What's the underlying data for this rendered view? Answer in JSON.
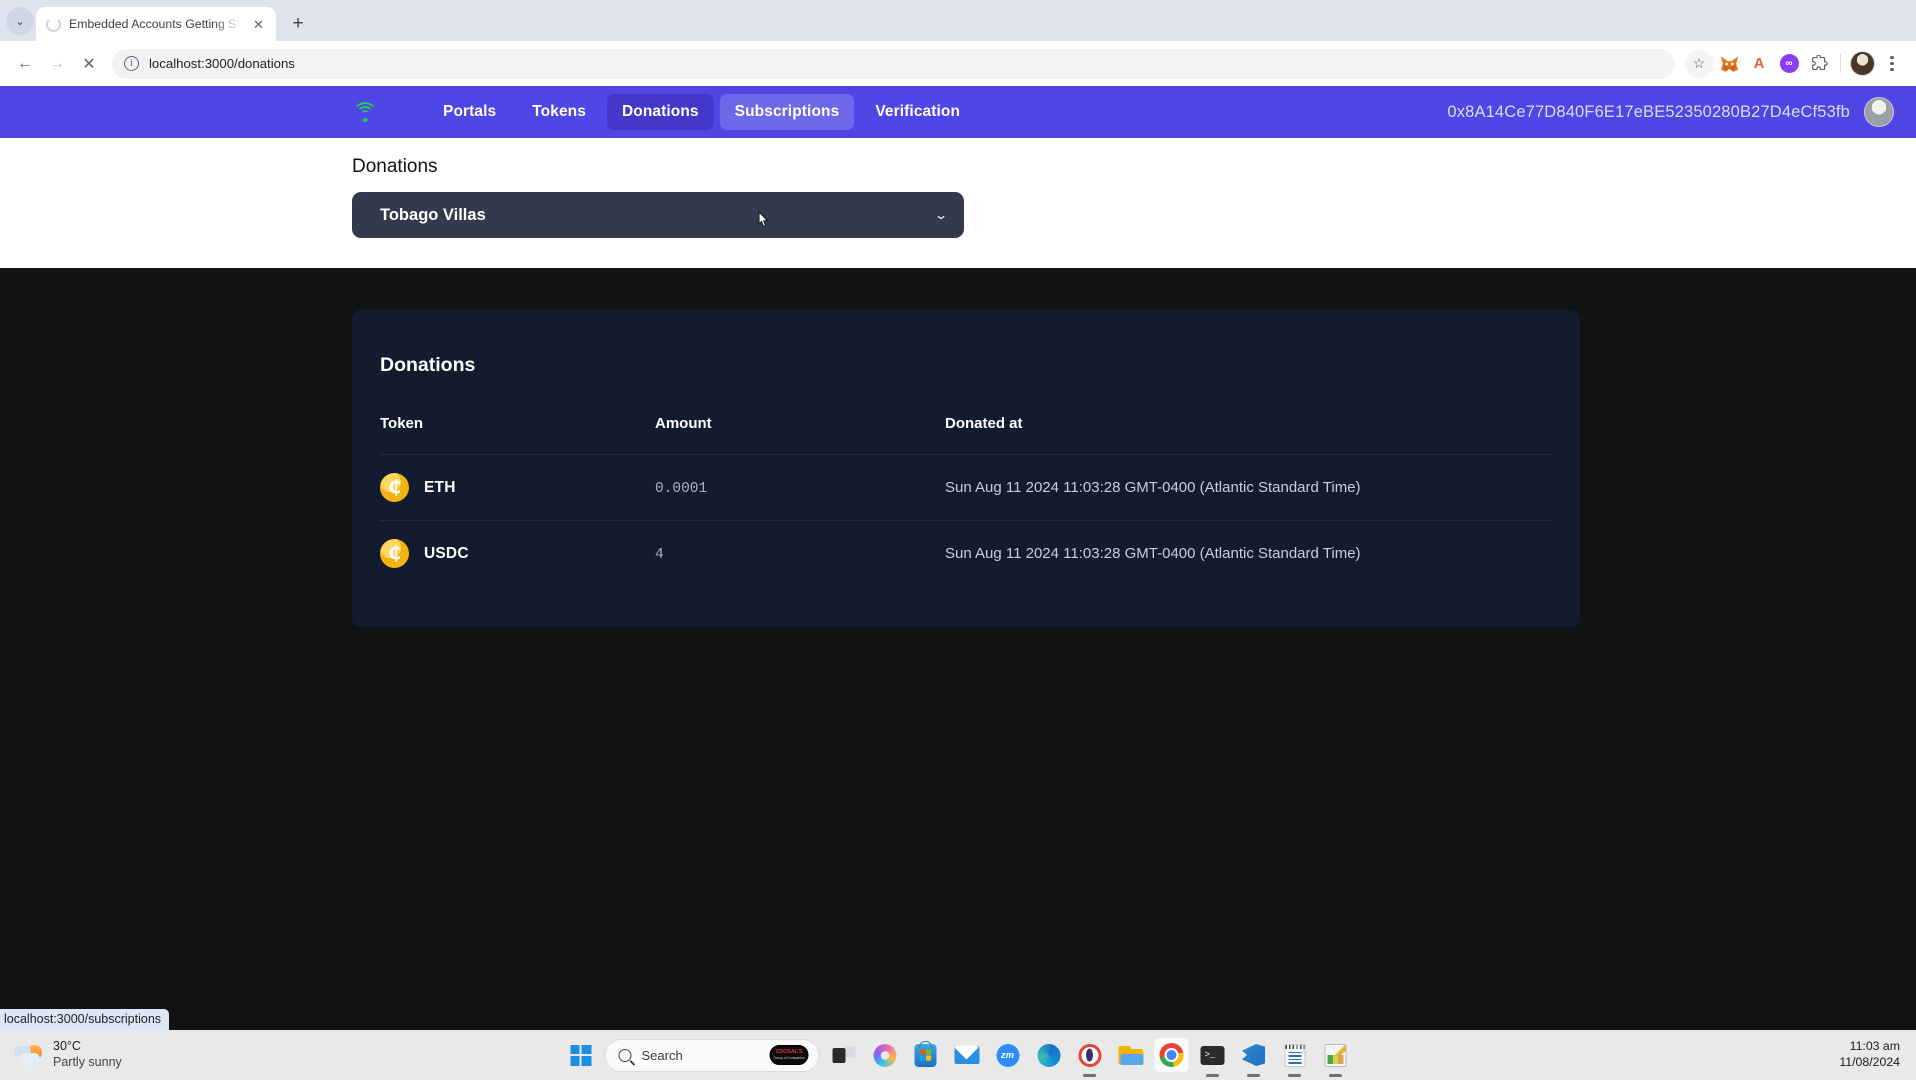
{
  "browser": {
    "tab": {
      "title": "Embedded Accounts Getting St",
      "close_label": "✕",
      "loading": true
    },
    "new_tab_label": "+",
    "tab_list_chevron": "⌄",
    "nav": {
      "back": "←",
      "forward": "→",
      "stop": "✕"
    },
    "omnibox": {
      "url": "localhost:3000/donations",
      "info_glyph": "i"
    },
    "toolbar_icons": [
      {
        "name": "bookmark-star-icon",
        "glyph": "☆"
      },
      {
        "name": "metamask-extension-icon",
        "glyph": "🦊"
      },
      {
        "name": "extension-a-icon",
        "glyph": "A"
      },
      {
        "name": "purple-extension-icon",
        "glyph": "∞"
      },
      {
        "name": "extensions-puzzle-icon",
        "glyph": "⬚"
      }
    ],
    "menu_label": "⋮",
    "status_bubble": "localhost:3000/subscriptions"
  },
  "app": {
    "brand_icon": "wifi-icon",
    "accent_color": "#4f46e5",
    "active_pill_color": "#4338ca",
    "nav_links": [
      {
        "label": "Portals",
        "state": "default"
      },
      {
        "label": "Tokens",
        "state": "default"
      },
      {
        "label": "Donations",
        "state": "active"
      },
      {
        "label": "Subscriptions",
        "state": "hover"
      },
      {
        "label": "Verification",
        "state": "default"
      }
    ],
    "wallet_address": "0x8A14Ce77D840F6E17eBE52350280B27D4eCf53fb",
    "avatar": "user-avatar"
  },
  "page": {
    "heading": "Donations",
    "portal_select": {
      "value": "Tobago Villas",
      "chevron": "⌄"
    },
    "card": {
      "title": "Donations",
      "columns": [
        "Token",
        "Amount",
        "Donated at"
      ],
      "rows": [
        {
          "token": "ETH",
          "token_icon": "coin-icon",
          "token_glyph": "₵",
          "amount": "0.0001",
          "donated_at": "Sun Aug 11 2024 11:03:28 GMT-0400 (Atlantic Standard Time)"
        },
        {
          "token": "USDC",
          "token_icon": "coin-icon",
          "token_glyph": "₵",
          "amount": "4",
          "donated_at": "Sun Aug 11 2024 11:03:28 GMT-0400 (Atlantic Standard Time)"
        }
      ]
    }
  },
  "taskbar": {
    "weather": {
      "temperature": "30°C",
      "condition": "Partly sunny"
    },
    "search_placeholder": "Search",
    "search_badge": {
      "line1": "CDOSAL'S",
      "line2": "Group of Companies"
    },
    "apps": [
      {
        "name": "start-button",
        "label": "Start"
      },
      {
        "name": "task-view-button",
        "label": "Task View"
      },
      {
        "name": "copilot-icon",
        "label": "Copilot"
      },
      {
        "name": "microsoft-store-icon",
        "label": "Microsoft Store"
      },
      {
        "name": "mail-icon",
        "label": "Mail"
      },
      {
        "name": "zoom-icon",
        "label": "Zoom"
      },
      {
        "name": "edge-icon",
        "label": "Microsoft Edge"
      },
      {
        "name": "opera-icon",
        "label": "Opera"
      },
      {
        "name": "file-explorer-icon",
        "label": "File Explorer"
      },
      {
        "name": "chrome-icon",
        "label": "Google Chrome"
      },
      {
        "name": "terminal-icon",
        "label": "Terminal"
      },
      {
        "name": "vscode-icon",
        "label": "Visual Studio Code"
      },
      {
        "name": "notepad-icon",
        "label": "Notepad"
      },
      {
        "name": "paint-icon",
        "label": "Paint"
      }
    ],
    "zoom_label": "zm",
    "terminal_glyph": ">_",
    "clock": {
      "time": "11:03 am",
      "date": "11/08/2024"
    }
  }
}
